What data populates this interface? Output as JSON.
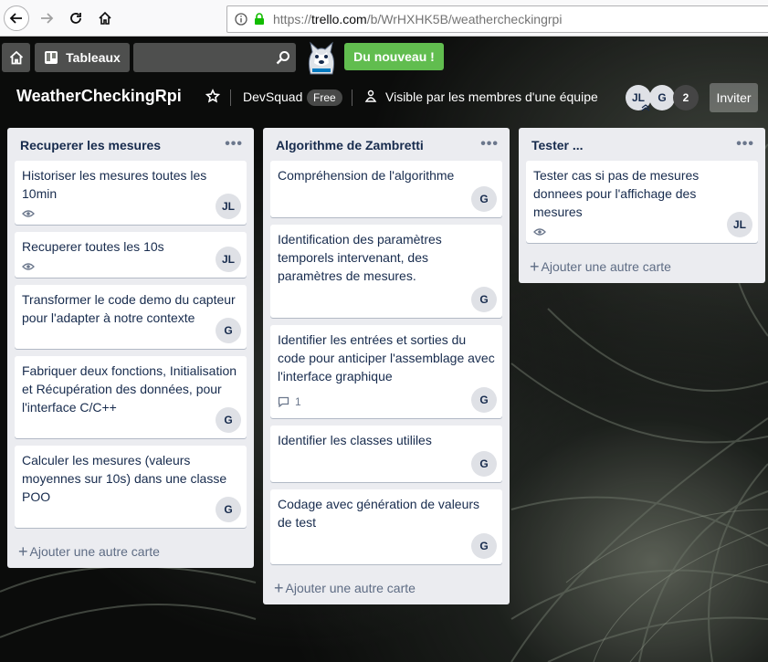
{
  "browser": {
    "url_prefix": "https://",
    "url_host": "trello.com",
    "url_path": "/b/WrHXHK5B/weathercheckingrpi"
  },
  "header": {
    "boards_label": "Tableaux",
    "news_label": "Du nouveau !"
  },
  "board": {
    "title": "WeatherCheckingRpi",
    "team": "DevSquad",
    "team_badge": "Free",
    "visibility": "Visible par les membres d'une équipe",
    "members": [
      "JL",
      "G"
    ],
    "more_members": "2",
    "invite_label": "Inviter"
  },
  "lists": [
    {
      "title": "Recuperer les mesures",
      "cards": [
        {
          "title": "Historiser les mesures toutes les 10min",
          "watch": true,
          "member": "JL"
        },
        {
          "title": "Recuperer toutes les 10s",
          "watch": true,
          "member": "JL"
        },
        {
          "title": "Transformer le code demo du capteur pour l'adapter à notre contexte",
          "member": "G"
        },
        {
          "title": "Fabriquer deux fonctions, Initialisation et Récupération des données, pour l'interface C/C++",
          "member": "G"
        },
        {
          "title": "Calculer les mesures (valeurs moyennes sur 10s) dans une classe POO",
          "member": "G"
        }
      ],
      "add_label": "Ajouter une autre carte"
    },
    {
      "title": "Algorithme de Zambretti",
      "cards": [
        {
          "title": "Compréhension de l'algorithme",
          "member": "G"
        },
        {
          "title": "Identification des paramètres temporels intervenant, des paramètres de mesures.",
          "member": "G"
        },
        {
          "title": "Identifier les entrées et sorties du code pour anticiper l'assemblage avec l'interface graphique",
          "comments": "1",
          "member": "G"
        },
        {
          "title": "Identifier les classes utililes",
          "member": "G"
        },
        {
          "title": "Codage avec génération de valeurs de test",
          "member": "G"
        }
      ],
      "add_label": "Ajouter une autre carte"
    },
    {
      "title": "Tester ...",
      "cards": [
        {
          "title": "Tester cas si pas de mesures donnees pour l'affichage des mesures",
          "watch": true,
          "member": "JL"
        }
      ],
      "add_label": "Ajouter une autre carte"
    }
  ],
  "colors": {
    "news_green": "#61bd4f",
    "list_bg": "#ebecf0",
    "card_text": "#172b4d",
    "muted_text": "#5e6c84"
  }
}
